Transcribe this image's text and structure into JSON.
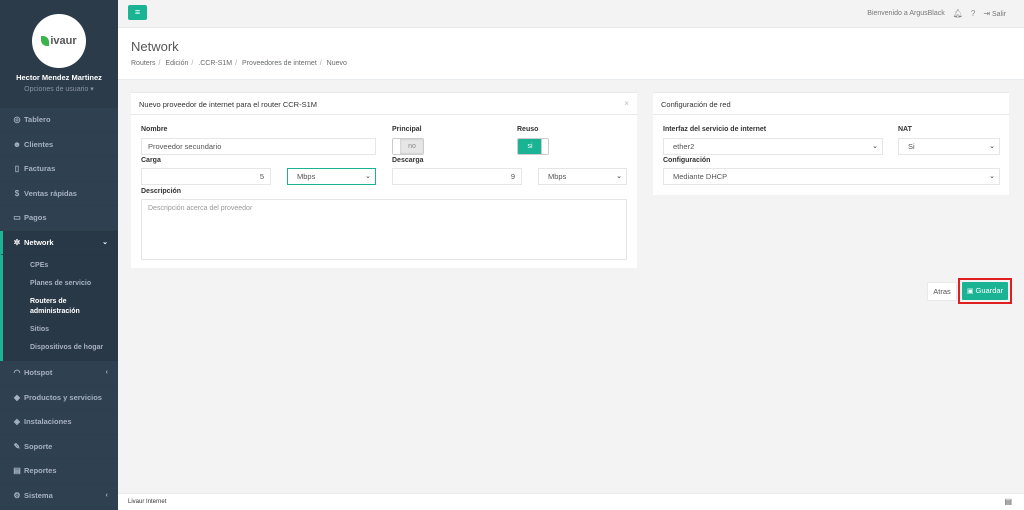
{
  "sidebar": {
    "logo_text": "ivaur",
    "user_name": "Hector Mendez Martinez",
    "user_options": "Opciones de usuario ▾",
    "items": [
      {
        "label": "Tablero",
        "icon": "dashboard-icon"
      },
      {
        "label": "Clientes",
        "icon": "users-icon"
      },
      {
        "label": "Facturas",
        "icon": "invoice-icon"
      },
      {
        "label": "Ventas rápidas",
        "icon": "dollar-icon"
      },
      {
        "label": "Pagos",
        "icon": "payments-icon"
      },
      {
        "label": "Network",
        "icon": "network-icon"
      },
      {
        "label": "Hotspot",
        "icon": "wifi-icon"
      },
      {
        "label": "Productos y servicios",
        "icon": "tag-icon"
      },
      {
        "label": "Instalaciones",
        "icon": "install-icon"
      },
      {
        "label": "Soporte",
        "icon": "wrench-icon"
      },
      {
        "label": "Reportes",
        "icon": "reports-icon"
      },
      {
        "label": "Sistema",
        "icon": "cogs-icon"
      }
    ],
    "network_sub": [
      "CPEs",
      "Planes de servicio",
      "Routers de administración",
      "Sitios",
      "Dispositivos de hogar"
    ]
  },
  "topbar": {
    "welcome": "Bienvenido a ArgusBlack",
    "logout": "Salir"
  },
  "page": {
    "title": "Network",
    "breadcrumbs": [
      "Routers",
      "Edición",
      ".CCR-S1M",
      "Proveedores de internet",
      "Nuevo"
    ]
  },
  "provider_panel": {
    "title": "Nuevo proveedor de internet para el router CCR-S1M",
    "close": "×",
    "nombre_label": "Nombre",
    "nombre_value": "Proveedor secundario",
    "principal_label": "Principal",
    "principal_value": "no",
    "reuso_label": "Reuso",
    "reuso_value": "si",
    "carga_label": "Carga",
    "carga_value": "5",
    "carga_unit": "Mbps",
    "descarga_label": "Descarga",
    "descarga_value": "9",
    "descarga_unit": "Mbps",
    "descripcion_label": "Descripción",
    "descripcion_placeholder": "Descripción acerca del proveedor"
  },
  "network_panel": {
    "title": "Configuración de red",
    "interfaz_label": "Interfaz del servicio de internet",
    "interfaz_value": "ether2",
    "nat_label": "NAT",
    "nat_value": "Si",
    "config_label": "Configuración",
    "config_value": "Mediante DHCP"
  },
  "actions": {
    "back": "Atras",
    "save": "Guardar"
  },
  "footer": {
    "text": "Livaur Internet"
  },
  "colors": {
    "accent": "#1ab394",
    "sidebar": "#2f4050",
    "highlight": "#e02020"
  }
}
